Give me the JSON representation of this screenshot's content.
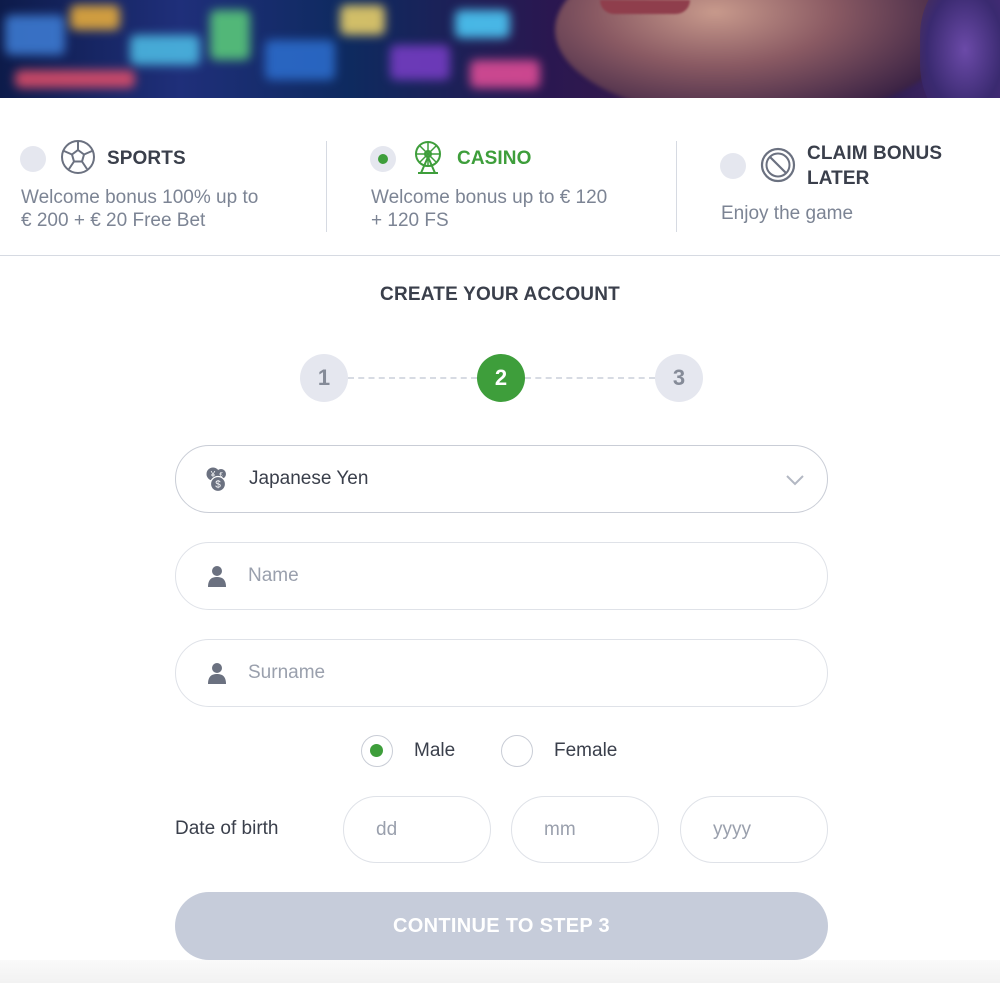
{
  "bonus_options": [
    {
      "title": "SPORTS",
      "description_lines": [
        "Welcome bonus 100% up to",
        "€ 200 + € 20 Free Bet"
      ],
      "selected": false,
      "icon": "soccer-ball-icon"
    },
    {
      "title": "CASINO",
      "description_lines": [
        "Welcome bonus up to € 120",
        "+ 120 FS"
      ],
      "selected": true,
      "icon": "ferris-wheel-icon"
    },
    {
      "title_lines": [
        "CLAIM BONUS",
        "LATER"
      ],
      "description": "Enjoy the game",
      "selected": false,
      "icon": "no-entry-icon"
    }
  ],
  "form": {
    "title": "CREATE YOUR ACCOUNT",
    "steps": [
      "1",
      "2",
      "3"
    ],
    "current_step": 2,
    "currency": {
      "value": "Japanese Yen",
      "icon": "currency-exchange-icon"
    },
    "name": {
      "placeholder": "Name",
      "value": ""
    },
    "surname": {
      "placeholder": "Surname",
      "value": ""
    },
    "gender": {
      "options": [
        "Male",
        "Female"
      ],
      "selected": "Male"
    },
    "dob": {
      "label": "Date of birth",
      "day_placeholder": "dd",
      "month_placeholder": "mm",
      "year_placeholder": "yyyy"
    },
    "continue_label": "CONTINUE TO STEP 3"
  },
  "colors": {
    "accent": "#3e9e3b",
    "text": "#3a3f4b",
    "muted": "#7c8494",
    "disabled_button": "#c6ccda",
    "border": "#dfe2e8"
  }
}
